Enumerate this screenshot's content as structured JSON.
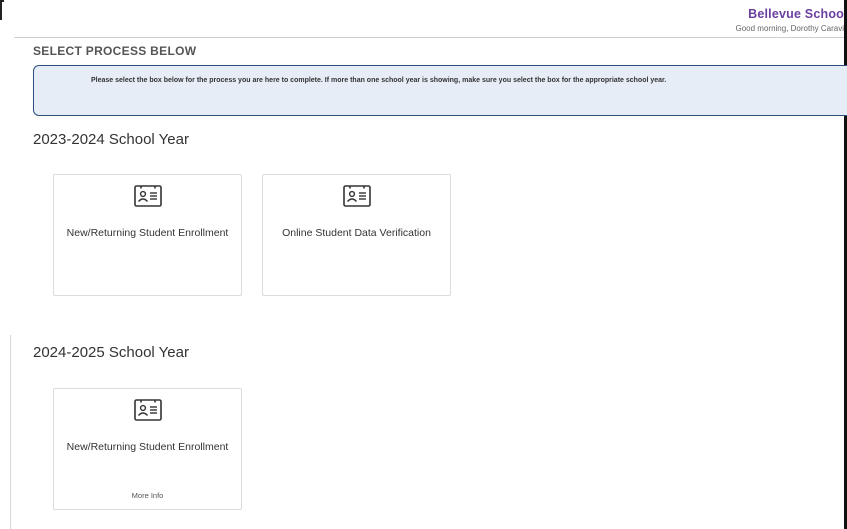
{
  "header": {
    "brand": "Bellevue Schoo",
    "greeting": "Good morning, Dorothy Caravi"
  },
  "page": {
    "title": "SELECT PROCESS BELOW",
    "notice": "Please select the box below for the process you are here to complete. If more than one school year is showing, make sure you select the box for the appropriate school year."
  },
  "sections": [
    {
      "title": "2023-2024 School Year",
      "cards": [
        {
          "label": "New/Returning Student Enrollment",
          "icon": "id-card-icon"
        },
        {
          "label": "Online Student Data Verification",
          "icon": "id-card-icon"
        }
      ]
    },
    {
      "title": "2024-2025 School Year",
      "cards": [
        {
          "label": "New/Returning Student Enrollment",
          "icon": "id-card-icon",
          "more": "More Info"
        }
      ]
    }
  ],
  "colors": {
    "brand": "#6b3fa0",
    "notice_bg": "#e6edf7",
    "notice_border": "#2d4f7c"
  }
}
